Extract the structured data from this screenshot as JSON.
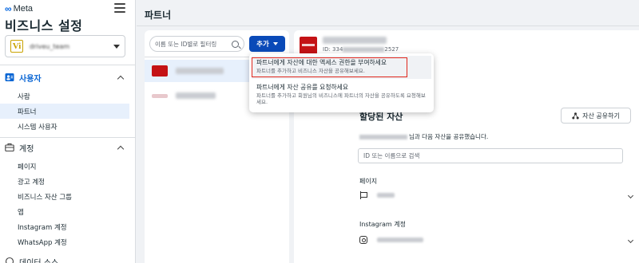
{
  "sidebar": {
    "logo": "Meta",
    "title": "비즈니스 설정",
    "account": {
      "avatar": "Vi",
      "name": "driveu_team"
    },
    "users_section": "사용자",
    "users_items": [
      {
        "label": "사람"
      },
      {
        "label": "파트너"
      },
      {
        "label": "시스템 사용자"
      }
    ],
    "accounts_section": "계정",
    "accounts_items": [
      {
        "label": "페이지"
      },
      {
        "label": "광고 계정"
      },
      {
        "label": "비즈니스 자산 그룹"
      },
      {
        "label": "앱"
      },
      {
        "label": "Instagram 계정"
      },
      {
        "label": "WhatsApp 계정"
      }
    ],
    "next_section_partial": "데이터 소스"
  },
  "main": {
    "title": "파트너",
    "filter_placeholder": "이름 또는 ID별로 필터링",
    "add_button": "추가",
    "partners": [
      {
        "logo_color": "#c41215"
      },
      {
        "logo_color": "#e8c8cc"
      }
    ]
  },
  "detail": {
    "id_prefix": "ID: 334",
    "id_suffix": "2527",
    "assets_title": "할당된 자산",
    "share_button": "자산 공유하기",
    "shared_text": "님과 다음 자산을 공유했습니다.",
    "search_placeholder": "ID 또는 이름으로 검색",
    "pages_label": "페이지",
    "instagram_label": "Instagram 계정"
  },
  "dropdown": {
    "items": [
      {
        "title": "파트너에게 자산에 대한 액세스 권한을 부여하세요",
        "desc": "파트너를 추가하고 비즈니스 자산을 공유해보세요."
      },
      {
        "title": "파트너에게 자산 공유를 요청하세요",
        "desc": "파트너를 추가하고 회원님의 비즈니스에 파트너의 자산을 공유하도록 요청해보세요."
      }
    ]
  },
  "colors": {
    "accent": "#0a4ab8",
    "link_blue": "#0a66d4",
    "highlight": "#e0251b",
    "brand_red": "#c41215"
  }
}
